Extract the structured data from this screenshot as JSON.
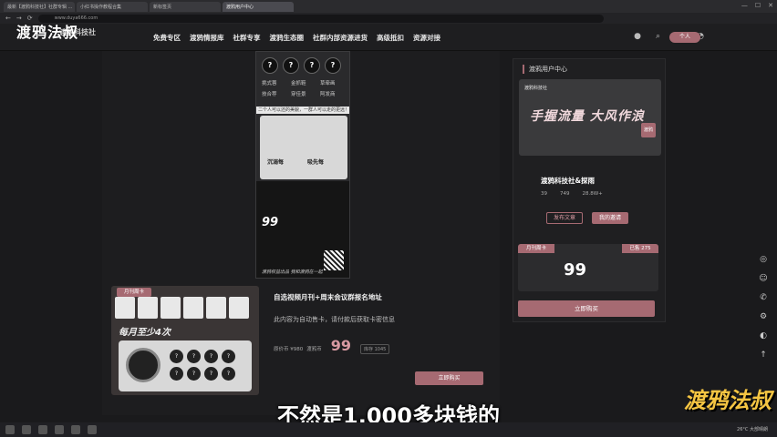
{
  "browser": {
    "tabs": [
      "最新【渡鸦科技社】社群专辑 ...",
      "小红书操作教程合集",
      "新标签页",
      "渡鸦用户中心"
    ],
    "active_tab": 3,
    "address": "www.duya666.com"
  },
  "watermark": {
    "top_left": "渡鸦法叔",
    "bottom_right": "渡鸦法叔"
  },
  "site": {
    "logo_sub": "渡鸦科技社",
    "nav": [
      "免费专区",
      "渡鸦情报库",
      "社群专享",
      "渡鸦生态圈",
      "社群内部资源进货",
      "高级抵扣",
      "资源对接"
    ],
    "user_label": "个人"
  },
  "poster": {
    "circles": [
      "?",
      "?",
      "?",
      "?"
    ],
    "names": [
      "挑式蓉",
      "金抓鞋",
      "草牵画",
      "技合荐",
      "穿佳景",
      "阿发商"
    ],
    "band_text": "二个人可以还的美貌，一群人可以走的更远！",
    "label_left": "沉溺每",
    "label_right": "吸先每",
    "price": "99",
    "footer": "渡鸦权益出品 我和渡鸦在一起"
  },
  "product": {
    "tag": "月刊周卡",
    "slogan": "每月至少4次",
    "dots": [
      "?",
      "?",
      "?",
      "?",
      "?",
      "?",
      "?",
      "?"
    ],
    "title": "自选视频月刊+周末会议群报名地址",
    "desc": "此内容为自动售卡，请付款后获取卡密信息",
    "price_label": "渡鸦币",
    "original": "原价币 ¥980",
    "price": "99",
    "stock": "库存 1045",
    "buy": "立即购买"
  },
  "sidebar": {
    "title": "渡鸦用户中心",
    "banner_logo": "渡鸦科技社",
    "banner_text": "手握流量 大风作浪",
    "banner_badge": "渡鸦",
    "org_name": "渡鸦科技社&探雨",
    "stats": [
      "39",
      "749",
      "28.8W+"
    ],
    "btn_publish": "发布文章",
    "btn_invite": "我的邀请",
    "vip_tag": "月刊周卡",
    "vip_tag2": "已售 275",
    "vip_price": "99",
    "vip_buy": "立即购买"
  },
  "subtitle": "不然是1,000多块钱的",
  "taskbar": {
    "status": "26°C 大部晴朗"
  }
}
